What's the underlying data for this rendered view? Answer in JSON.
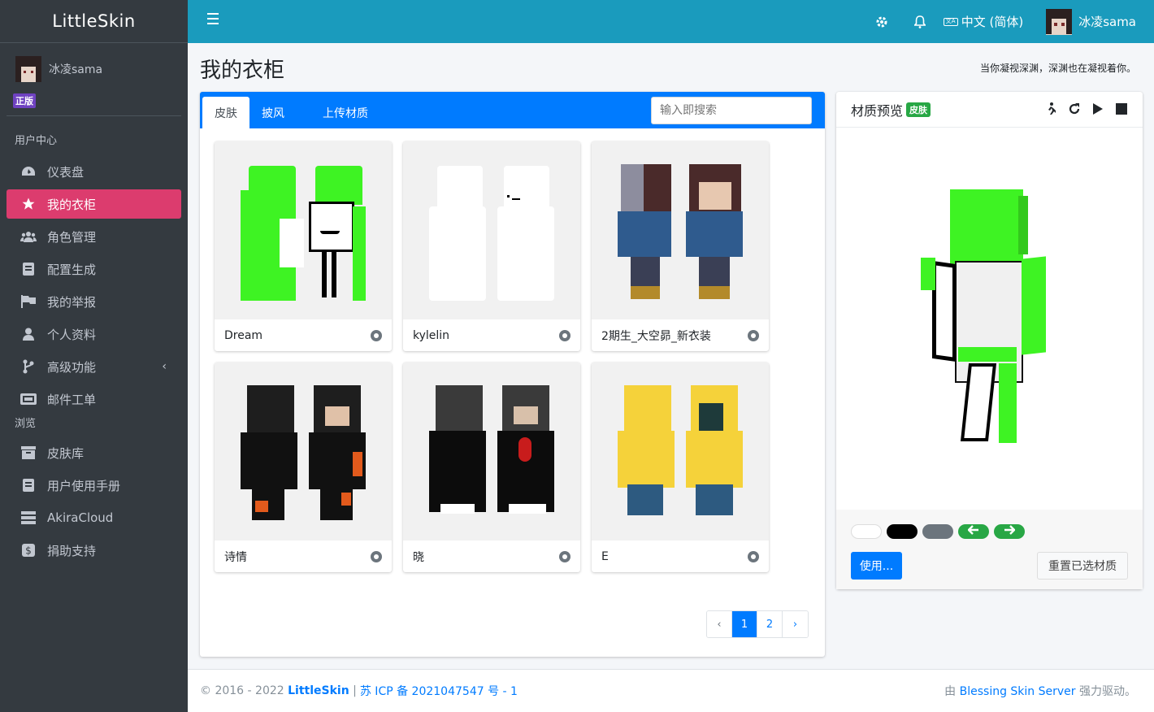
{
  "brand": {
    "name": "LittleSkin"
  },
  "user": {
    "name": "冰凌sama",
    "badge": "正版"
  },
  "sidebar": {
    "sections": [
      {
        "header": "用户中心",
        "items": [
          {
            "label": "仪表盘",
            "icon": "dashboard-icon"
          },
          {
            "label": "我的衣柜",
            "icon": "star-icon",
            "active": true
          },
          {
            "label": "角色管理",
            "icon": "users-icon"
          },
          {
            "label": "配置生成",
            "icon": "file-icon"
          },
          {
            "label": "我的举报",
            "icon": "flag-icon"
          },
          {
            "label": "个人资料",
            "icon": "user-icon"
          },
          {
            "label": "高级功能",
            "icon": "fork-icon"
          },
          {
            "label": "邮件工单",
            "icon": "ticket-icon"
          }
        ]
      },
      {
        "header": "浏览",
        "items": [
          {
            "label": "皮肤库",
            "icon": "archive-icon"
          },
          {
            "label": "用户使用手册",
            "icon": "book-icon"
          },
          {
            "label": "AkiraCloud",
            "icon": "server-icon"
          },
          {
            "label": "捐助支持",
            "icon": "donate-icon"
          }
        ]
      }
    ]
  },
  "topbar": {
    "language": "中文 (简体)",
    "username": "冰凌sama"
  },
  "page": {
    "title": "我的衣柜",
    "slogan": "当你凝视深渊，深渊也在凝视着你。"
  },
  "closet": {
    "tabs": [
      "皮肤",
      "披风",
      "上传材质"
    ],
    "active_tab": "皮肤",
    "search_placeholder": "输入即搜索",
    "items": [
      {
        "name": "Dream"
      },
      {
        "name": "kylelin"
      },
      {
        "name": "2期生_大空昴_新衣装"
      },
      {
        "name": "诗情"
      },
      {
        "name": "晓"
      },
      {
        "name": "E"
      }
    ],
    "pagination": {
      "prev": "‹",
      "pages": [
        "1",
        "2"
      ],
      "current": "1",
      "next": "›"
    }
  },
  "preview": {
    "title": "材质预览",
    "badge": "皮肤",
    "use_button": "使用...",
    "reset_button": "重置已选材质",
    "background_colors": [
      "#ffffff",
      "#000000",
      "#6c757d"
    ],
    "nav_colors": "#28a745"
  },
  "footer": {
    "copyright_prefix": "© 2016 - 2022",
    "site": "LittleSkin",
    "separator": "|",
    "icp": "苏 ICP 备 2021047547 号 - 1",
    "powered_prefix": "由",
    "powered_name": "Blessing Skin Server",
    "powered_suffix": "强力驱动。"
  }
}
